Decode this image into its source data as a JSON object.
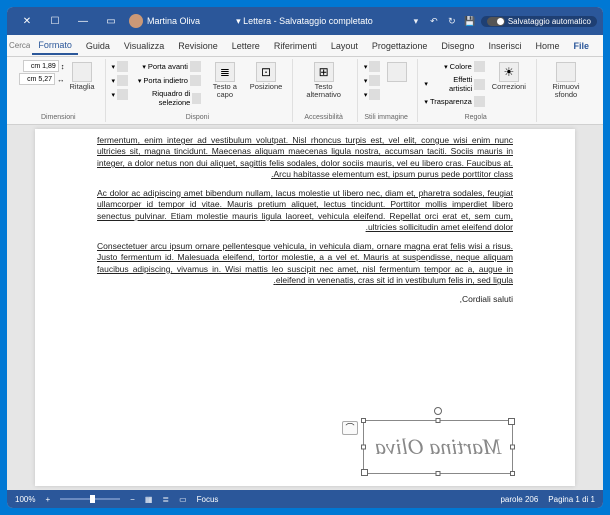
{
  "titlebar": {
    "autosave_label": "Salvataggio automatico",
    "doc_title": "Lettera - Salvataggio completato ▾",
    "user_name": "Martina Oliva"
  },
  "tabs": {
    "file": "File",
    "home": "Home",
    "insert": "Inserisci",
    "design": "Disegno",
    "layout": "Progettazione",
    "layout2": "Layout",
    "references": "Riferimenti",
    "mailings": "Lettere",
    "review": "Revisione",
    "view": "Visualizza",
    "help": "Guida",
    "format": "Formato",
    "search_placeholder": "Cerca"
  },
  "ribbon": {
    "remove_bg": "Rimuovi sfondo",
    "corrections": "Correzioni",
    "color": "Colore",
    "artistic": "Effetti artistici",
    "transparency": "Trasparenza",
    "adjust_label": "Regola",
    "styles_label": "Stili immagine",
    "alt_text": "Testo alternativo",
    "access_label": "Accessibilità",
    "position": "Posizione",
    "wrap": "Testo a capo",
    "bring_fwd": "Porta avanti",
    "send_back": "Porta indietro",
    "selection": "Riquadro di selezione",
    "arrange_label": "Disponi",
    "crop": "Ritaglia",
    "height_label": "↕",
    "width_label": "↔",
    "height_val": "1,89 cm",
    "width_val": "5,27 cm",
    "size_label": "Dimensioni"
  },
  "document": {
    "p1": "fermentum, enim integer ad vestibulum volutpat. Nisl rhoncus turpis est, vel elit, congue wisi enim nunc ultricies sit, magna tincidunt. Maecenas aliquam maecenas ligula nostra, accumsan taciti. Sociis mauris in integer, a dolor netus non dui aliquet, sagittis felis sodales, dolor sociis mauris, vel eu libero cras. Faucibus at. Arcu habitasse elementum est, ipsum purus pede porttitor class.",
    "p2": "Ac dolor ac adipiscing amet bibendum nullam, lacus molestie ut libero nec, diam et, pharetra sodales, feugiat ullamcorper id tempor id vitae. Mauris pretium aliquet, lectus tincidunt. Porttitor mollis imperdiet libero senectus pulvinar. Etiam molestie mauris ligula laoreet, vehicula eleifend. Repellat orci erat et, sem cum, ultricies sollicitudin amet eleifend dolor.",
    "p3": "Consectetuer arcu ipsum ornare pellentesque vehicula, in vehicula diam, ornare magna erat felis wisi a risus. Justo fermentum id. Malesuada eleifend, tortor molestie, a a vel et. Mauris at suspendisse, neque aliquam faucibus adipiscing, vivamus in. Wisi mattis leo suscipit nec amet, nisl fermentum tempor ac a, augue in eleifend in venenatis, cras sit id in vestibulum felis in, sed ligula.",
    "closing": "Cordiali saluti,",
    "signature": "Martina Oliva"
  },
  "statusbar": {
    "page": "Pagina 1 di 1",
    "words": "206 parole",
    "focus": "Focus",
    "zoom": "100%"
  }
}
